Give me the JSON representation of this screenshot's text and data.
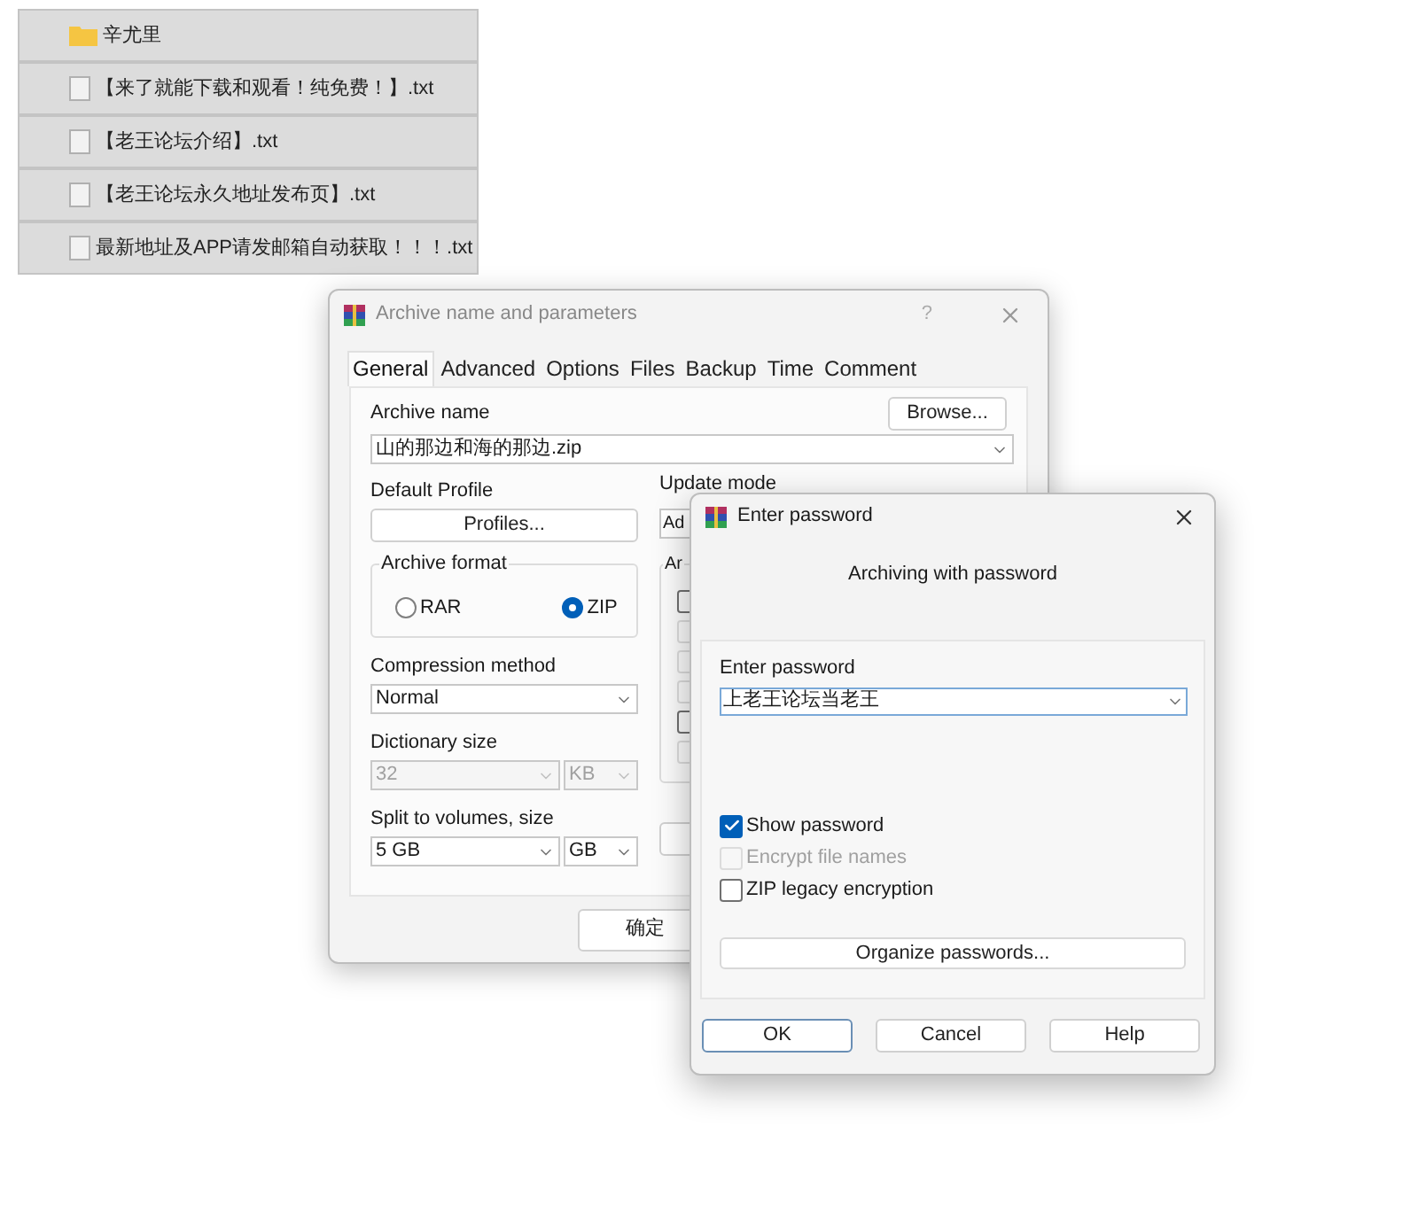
{
  "file_list": [
    {
      "kind": "folder",
      "name": "辛尤里"
    },
    {
      "kind": "file",
      "name": "【来了就能下载和观看！纯免费！】.txt"
    },
    {
      "kind": "file",
      "name": "【老王论坛介绍】.txt"
    },
    {
      "kind": "file",
      "name": "【老王论坛永久地址发布页】.txt"
    },
    {
      "kind": "file",
      "name": "最新地址及APP请发邮箱自动获取！！！.txt"
    }
  ],
  "archive_dialog": {
    "title": "Archive name and parameters",
    "help_button": "?",
    "tabs": [
      {
        "label": "General",
        "selected": true
      },
      {
        "label": "Advanced",
        "selected": false
      },
      {
        "label": "Options",
        "selected": false
      },
      {
        "label": "Files",
        "selected": false
      },
      {
        "label": "Backup",
        "selected": false
      },
      {
        "label": "Time",
        "selected": false
      },
      {
        "label": "Comment",
        "selected": false
      }
    ],
    "archive_name": {
      "label": "Archive name",
      "value": "山的那边和海的那边.zip",
      "browse_button": "Browse..."
    },
    "default_profile": {
      "label": "Default Profile",
      "button": "Profiles..."
    },
    "update_mode": {
      "label": "Update mode",
      "value": "Ad"
    },
    "archive_format": {
      "label": "Archive format",
      "options": [
        {
          "label": "RAR",
          "selected": false
        },
        {
          "label": "ZIP",
          "selected": true
        }
      ]
    },
    "archive_options": {
      "label": "Ar",
      "checkboxes": [
        {
          "disabled": false
        },
        {
          "disabled": true
        },
        {
          "disabled": true
        },
        {
          "disabled": true
        },
        {
          "disabled": false
        },
        {
          "disabled": true
        }
      ]
    },
    "compression_method": {
      "label": "Compression method",
      "value": "Normal"
    },
    "dictionary_size": {
      "label": "Dictionary size",
      "value": "32",
      "unit": "KB",
      "disabled": true
    },
    "split_volumes": {
      "label": "Split to volumes, size",
      "value": "5 GB",
      "unit": "GB"
    },
    "ok_button": "确定"
  },
  "password_dialog": {
    "title": "Enter password",
    "subtitle": "Archiving with password",
    "password": {
      "label": "Enter password",
      "value": "上老王论坛当老王"
    },
    "options": [
      {
        "label": "Show password",
        "checked": true,
        "disabled": false
      },
      {
        "label": "Encrypt file names",
        "checked": false,
        "disabled": true
      },
      {
        "label": "ZIP legacy encryption",
        "checked": false,
        "disabled": false
      }
    ],
    "organize_button": "Organize passwords...",
    "buttons": [
      {
        "label": "OK",
        "default": true
      },
      {
        "label": "Cancel",
        "default": false
      },
      {
        "label": "Help",
        "default": false
      }
    ]
  }
}
